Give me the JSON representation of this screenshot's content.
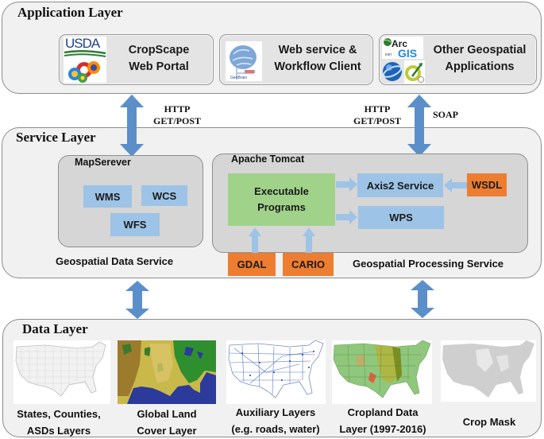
{
  "application_layer": {
    "title": "Application  Layer",
    "cards": [
      {
        "line1": "CropScape",
        "line2": "Web Portal",
        "logo": "usda-browsers-logo"
      },
      {
        "line1": "Web service &",
        "line2": "Workflow  Client",
        "logo": "geobrain-logo"
      },
      {
        "line1": "Other Geospatial",
        "line2": "Applications",
        "logo": "arcgis-googleearth-qgis-logos"
      }
    ],
    "usda_text": "USDA",
    "arcgis_text_1": "Arc",
    "arcgis_text_2": "GIS",
    "esri_text": "esri"
  },
  "connectors_top": {
    "left_label_1": "HTTP",
    "left_label_2": "GET/POST",
    "right_label_1": "HTTP",
    "right_label_2": "GET/POST",
    "right_label_soap": "SOAP"
  },
  "service_layer": {
    "title": "Service Layer",
    "mapserver": {
      "title": "MapSerever",
      "services": [
        "WMS",
        "WCS",
        "WFS"
      ],
      "caption": "Geospatial Data Service"
    },
    "tomcat": {
      "title": "Apache Tomcat",
      "executable_line1": "Executable",
      "executable_line2": "Programs",
      "axis2": "Axis2 Service",
      "wps": "WPS",
      "wsdl": "WSDL",
      "libs": [
        "GDAL",
        "CARIO"
      ],
      "caption": "Geospatial Processing Service"
    }
  },
  "data_layer": {
    "title": "Data Layer",
    "items": [
      {
        "line1": "States, Counties,",
        "line2": "ASDs Layers",
        "map_style": "gray-county-lines"
      },
      {
        "line1": "Global Land",
        "line2": "Cover Layer",
        "map_style": "land-cover-color"
      },
      {
        "line1": "Auxiliary Layers",
        "line2": "(e.g. roads, water)",
        "map_style": "blue-road-network"
      },
      {
        "line1": "Cropland Data",
        "line2": "Layer (1997-2016)",
        "map_style": "green-cropland"
      },
      {
        "line1": "Crop Mask",
        "line2": "",
        "map_style": "gray-crop-mask"
      }
    ]
  },
  "colors": {
    "arrow_blue": "#5b8fc9",
    "light_blue": "#9dc3e6",
    "orange": "#ed7d31",
    "green": "#a0d28a",
    "layer_bg": "#f1f1f1",
    "container_bg": "#d6d6d6"
  }
}
